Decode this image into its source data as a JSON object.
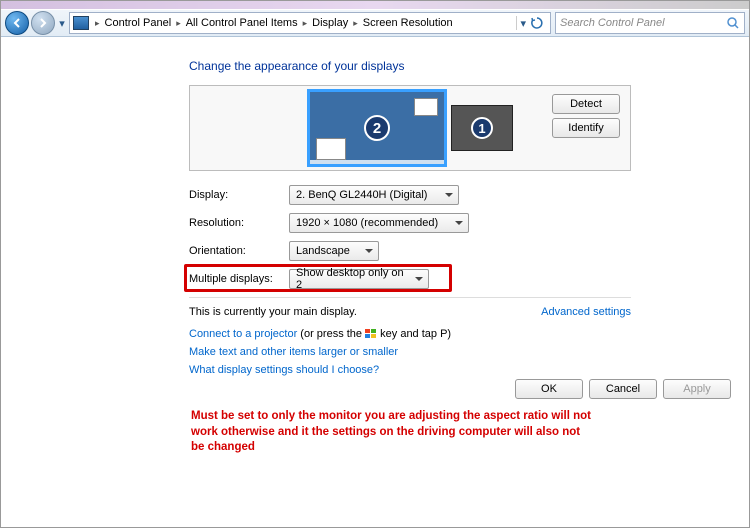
{
  "breadcrumb": {
    "items": [
      "Control Panel",
      "All Control Panel Items",
      "Display",
      "Screen Resolution"
    ]
  },
  "search": {
    "placeholder": "Search Control Panel"
  },
  "heading": "Change the appearance of your displays",
  "preview": {
    "monitor1_num": "1",
    "monitor2_num": "2",
    "detect": "Detect",
    "identify": "Identify"
  },
  "form": {
    "display_label": "Display:",
    "display_value": "2. BenQ GL2440H (Digital)",
    "resolution_label": "Resolution:",
    "resolution_value": "1920 × 1080 (recommended)",
    "orientation_label": "Orientation:",
    "orientation_value": "Landscape",
    "multi_label": "Multiple displays:",
    "multi_value": "Show desktop only on 2"
  },
  "status": {
    "main_display": "This is currently your main display.",
    "advanced": "Advanced settings"
  },
  "links": {
    "projector_pre": "Connect to a projector",
    "projector_post": " (or press the ",
    "projector_end": " key and tap P)",
    "text_size": "Make text and other items larger or smaller",
    "which": "What display settings should I choose?"
  },
  "buttons": {
    "ok": "OK",
    "cancel": "Cancel",
    "apply": "Apply"
  },
  "note": "Must be set to only the monitor you are adjusting the aspect ratio will not work otherwise and it the settings on the driving computer will  also not be changed"
}
